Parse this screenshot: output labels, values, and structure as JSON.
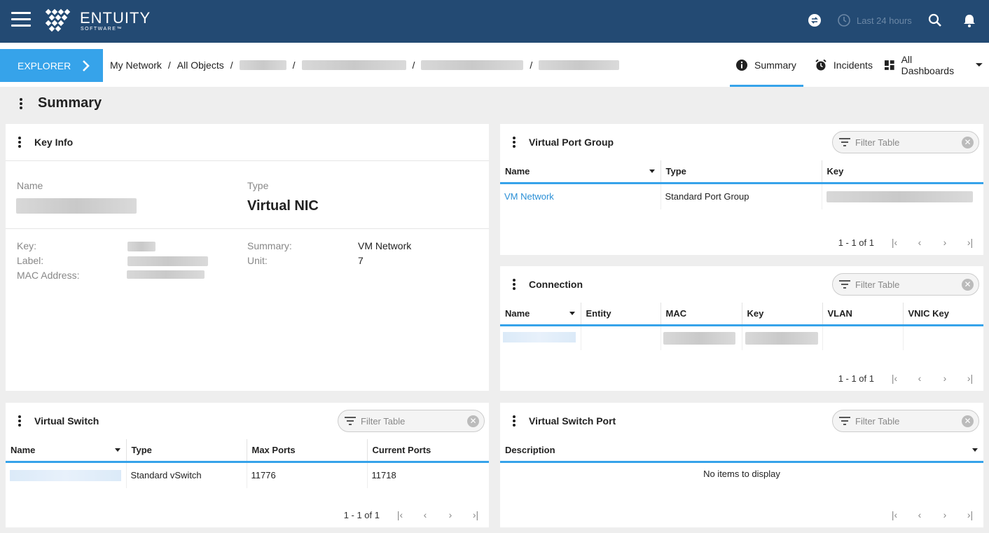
{
  "header": {
    "logo_text": "ENTUITY",
    "logo_sub": "SOFTWARE™",
    "timeframe": "Last 24 hours"
  },
  "nav": {
    "explorer_label": "EXPLORER",
    "breadcrumb": [
      "My Network",
      "All Objects"
    ],
    "tabs": [
      {
        "label": "Summary"
      },
      {
        "label": "Incidents"
      },
      {
        "label": "All Dashboards"
      }
    ]
  },
  "page": {
    "title": "Summary"
  },
  "key_info": {
    "title": "Key Info",
    "name_label": "Name",
    "type_label": "Type",
    "type_value": "Virtual NIC",
    "key_label": "Key:",
    "label_label": "Label:",
    "mac_label": "MAC Address:",
    "summary_label": "Summary:",
    "summary_value": "VM Network",
    "unit_label": "Unit:",
    "unit_value": "7"
  },
  "virtual_port_group": {
    "title": "Virtual Port Group",
    "filter_placeholder": "Filter Table",
    "columns": [
      "Name",
      "Type",
      "Key"
    ],
    "rows": [
      {
        "name": "VM Network",
        "type": "Standard Port Group"
      }
    ],
    "pager": "1 - 1 of 1"
  },
  "connection": {
    "title": "Connection",
    "filter_placeholder": "Filter Table",
    "columns": [
      "Name",
      "Entity",
      "MAC",
      "Key",
      "VLAN",
      "VNIC Key"
    ],
    "pager": "1 - 1 of 1"
  },
  "virtual_switch": {
    "title": "Virtual Switch",
    "filter_placeholder": "Filter Table",
    "columns": [
      "Name",
      "Type",
      "Max Ports",
      "Current Ports"
    ],
    "rows": [
      {
        "type": "Standard vSwitch",
        "max_ports": "11776",
        "current_ports": "11718"
      }
    ],
    "pager": "1 - 1 of 1"
  },
  "virtual_switch_port": {
    "title": "Virtual Switch Port",
    "filter_placeholder": "Filter Table",
    "columns": [
      "Description"
    ],
    "empty_text": "No items to display"
  },
  "colors": {
    "topbar": "#234a73",
    "accent": "#36a3ea",
    "link": "#2a8fd6"
  }
}
